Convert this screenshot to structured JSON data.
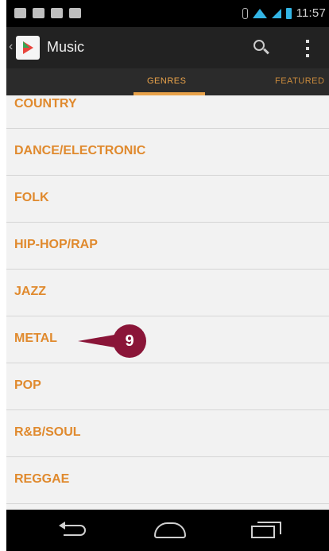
{
  "status_bar": {
    "time": "11:57",
    "left_icons": [
      "message-icon",
      "gmail-icon",
      "sd-card-icon",
      "game-controller-icon"
    ],
    "right_icons": [
      "bluetooth-icon",
      "wifi-icon",
      "signal-icon",
      "battery-icon"
    ]
  },
  "action_bar": {
    "title": "Music",
    "app_icon": "play-store-icon",
    "actions": [
      "search-icon",
      "overflow-menu-icon"
    ]
  },
  "tabs": [
    {
      "label": "GENRES",
      "selected": true
    },
    {
      "label": "FEATURED",
      "selected": false
    }
  ],
  "genres": [
    "COUNTRY",
    "DANCE/ELECTRONIC",
    "FOLK",
    "HIP-HOP/RAP",
    "JAZZ",
    "METAL",
    "POP",
    "R&B/SOUL",
    "REGGAE"
  ],
  "callout": {
    "number": "9",
    "color": "#8a1538"
  },
  "nav_bar": [
    "back-icon",
    "home-icon",
    "recent-apps-icon"
  ],
  "colors": {
    "accent": "#e08a2e",
    "tab_accent": "#e8a24a",
    "list_background": "#f2f2f2",
    "action_bar": "#222222"
  }
}
